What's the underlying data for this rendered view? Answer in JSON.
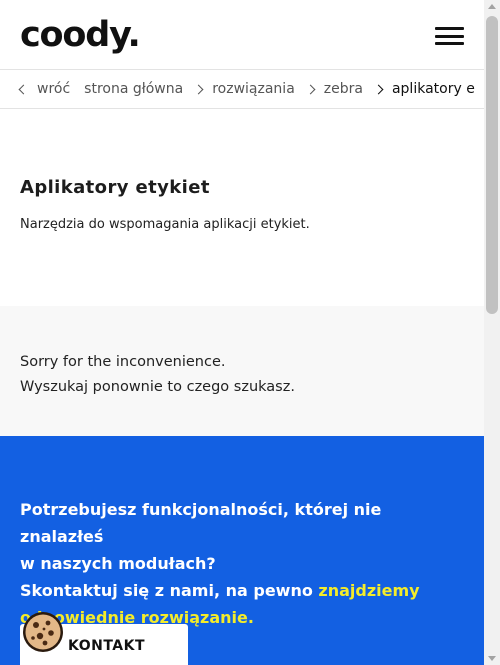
{
  "header": {
    "logo": "coody.",
    "menu_icon": "hamburger-menu-icon"
  },
  "breadcrumb": {
    "back": "wróć",
    "items": [
      "strona główna",
      "rozwiązania",
      "zebra"
    ],
    "current": "aplikatory e"
  },
  "hero": {
    "title": "Aplikatory etykiet",
    "description": "Narzędzia do wspomagania aplikacji etykiet."
  },
  "notice": {
    "line1": "Sorry for the inconvenience.",
    "line2": "Wyszukaj ponownie to czego szukasz."
  },
  "cta": {
    "line1": "Potrzebujesz funkcjonalności, której nie znalazłeś",
    "line2": "w naszych modułach?",
    "line3_pre": "Skontaktuj się z nami, na pewno ",
    "line3_hl": "znajdziemy",
    "line4_hl": "odpowiednie rozwiązanie.",
    "button": "KONTAKT"
  },
  "cookie": {
    "icon": "cookie-icon"
  },
  "colors": {
    "cta_bg": "#1360e2",
    "highlight": "#f4ec2a",
    "notice_bg": "#f8f8f8"
  }
}
